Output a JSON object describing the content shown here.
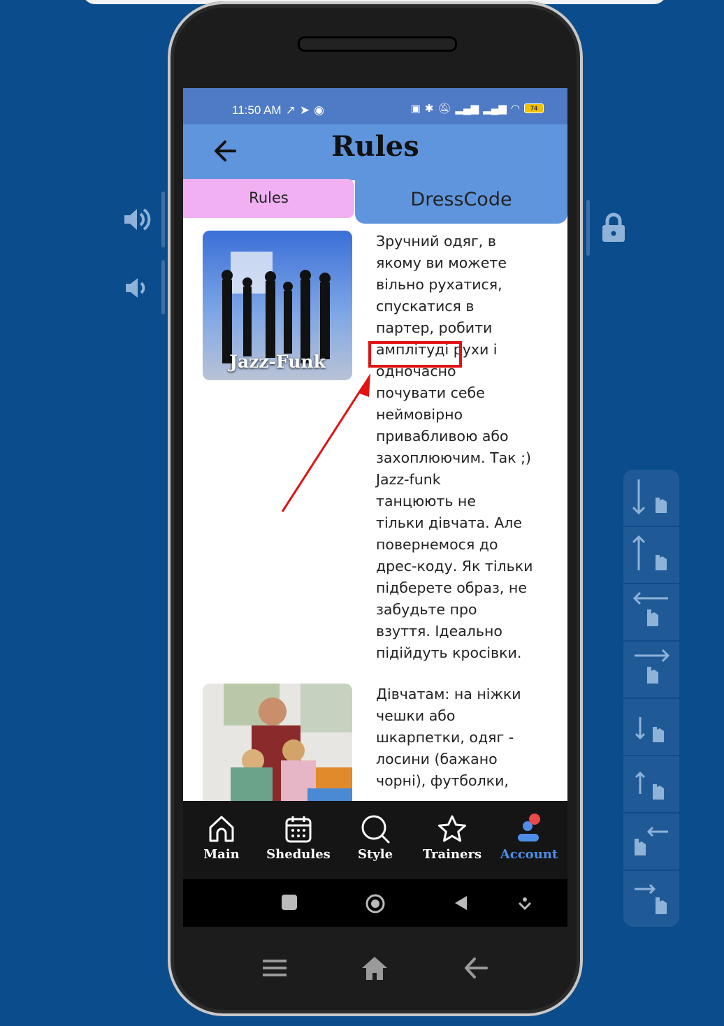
{
  "status_bar": {
    "time": "11:50 AM",
    "battery": "74"
  },
  "header": {
    "title": "Rules"
  },
  "tabs": {
    "rules": "Rules",
    "dresscode": "DressCode"
  },
  "cards": [
    {
      "caption": "Jazz-Funk",
      "lines": [
        "Зручний одяг, в",
        "якому ви можете",
        "вільно рухатися,",
        "спускатися в",
        "партер, робити",
        "амплітуді рухи і",
        "одночасно",
        "почувати себе",
        "неймовірно",
        "привабливою або",
        "захоплюючим. Так ;)",
        "Jazz-funk",
        "танцюють не",
        "тільки дівчата. Але",
        "повернемося до",
        "дрес-коду. Як тільки",
        "підберете образ, не",
        "забудьте про",
        "взуття. Ідеально",
        "підійдуть кросівки."
      ]
    },
    {
      "caption": "",
      "lines": [
        "Дівчатам: на ніжки",
        "чешки або",
        "шкарпетки, одяг -",
        "лосини (бажано",
        "чорні), футболки,"
      ]
    }
  ],
  "nav": {
    "main": "Main",
    "schedules": "Shedules",
    "style": "Style",
    "trainers": "Trainers",
    "account": "Account"
  },
  "colors": {
    "background": "#0a4c8c",
    "header": "#5f95dd",
    "rules_tab": "#f0b0f2",
    "nav_active": "#4f8ee6",
    "annotation": "#e01414"
  }
}
